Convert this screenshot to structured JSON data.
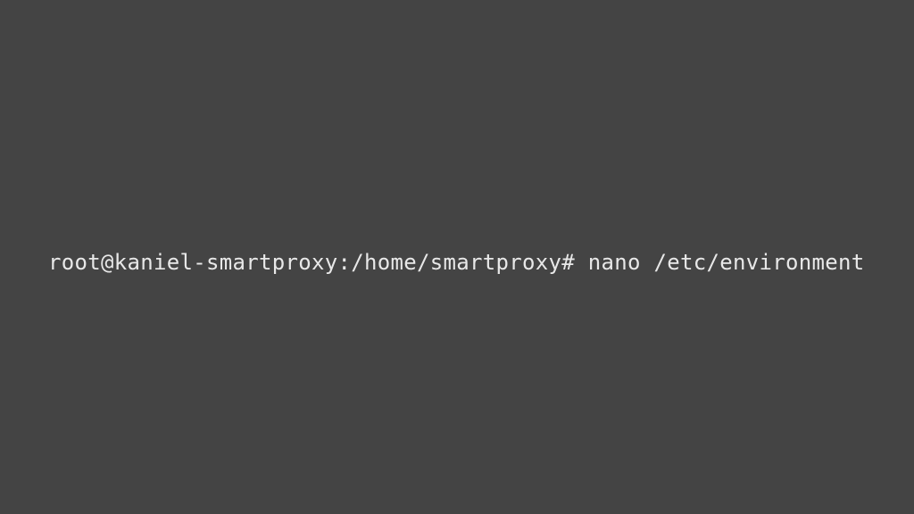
{
  "terminal": {
    "prompt": "root@kaniel-smartproxy:/home/smartproxy# ",
    "command": "nano /etc/environment"
  }
}
